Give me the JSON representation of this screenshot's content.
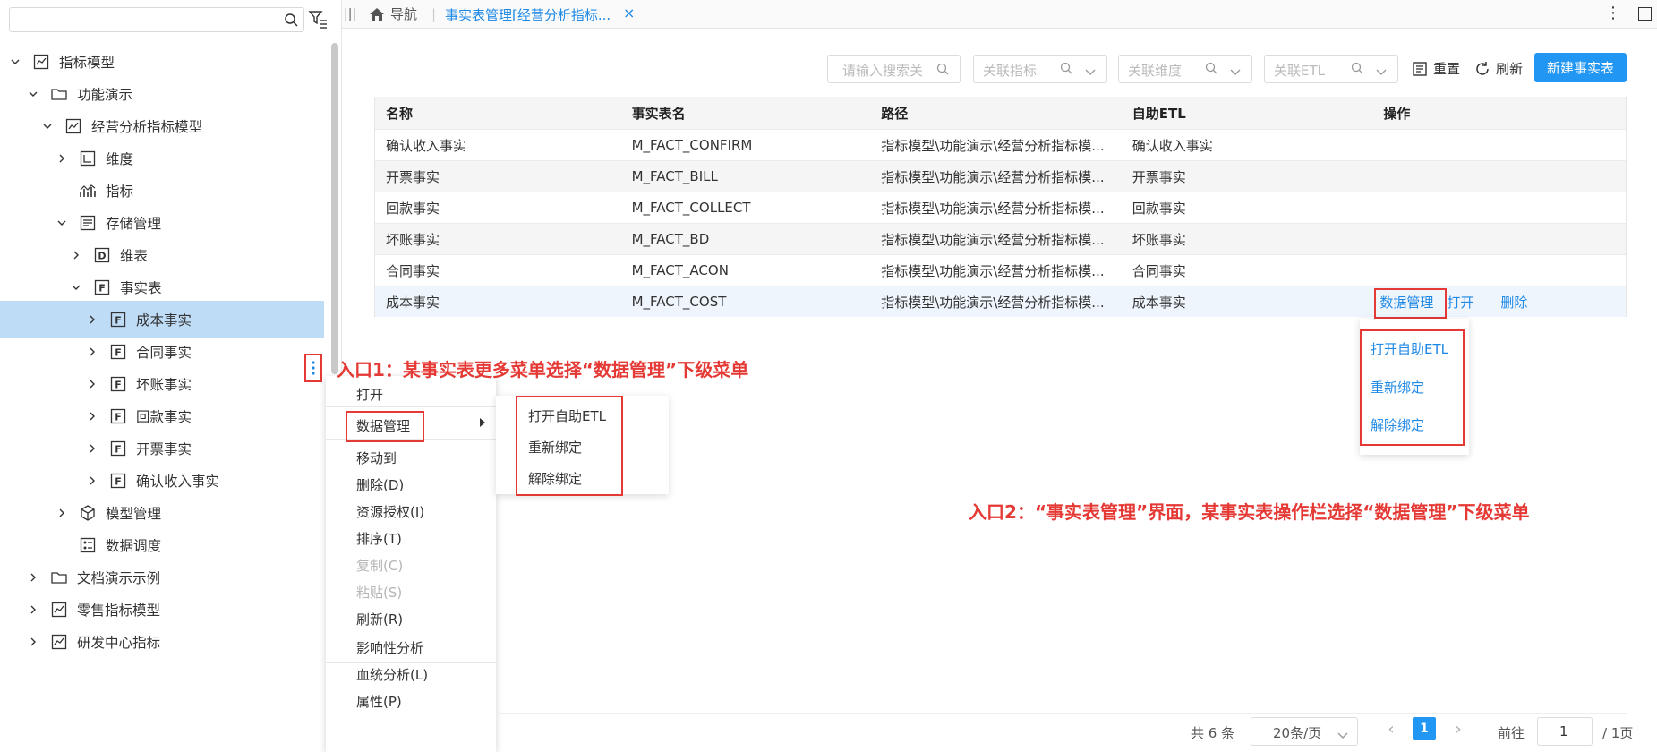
{
  "topbar": {
    "nav_label": "导航",
    "tab_label": "事实表管理[经营分析指标...",
    "tab_close": "×"
  },
  "sidebar": {
    "items": [
      {
        "label": "指标模型",
        "icon": "model-icon",
        "expanded": true
      },
      {
        "label": "功能演示",
        "icon": "folder-icon",
        "expanded": true
      },
      {
        "label": "经营分析指标模型",
        "icon": "model-icon",
        "expanded": true
      },
      {
        "label": "维度",
        "icon": "dimension-icon",
        "expanded": false
      },
      {
        "label": "指标",
        "icon": "metric-icon"
      },
      {
        "label": "存储管理",
        "icon": "storage-icon",
        "expanded": true
      },
      {
        "label": "维表",
        "icon": "dim-table-icon",
        "expanded": false
      },
      {
        "label": "事实表",
        "icon": "fact-table-icon",
        "expanded": true
      },
      {
        "label": "成本事实",
        "icon": "fact-table-icon",
        "expanded": false,
        "selected": true
      },
      {
        "label": "合同事实",
        "icon": "fact-table-icon",
        "expanded": false
      },
      {
        "label": "坏账事实",
        "icon": "fact-table-icon",
        "expanded": false
      },
      {
        "label": "回款事实",
        "icon": "fact-table-icon",
        "expanded": false
      },
      {
        "label": "开票事实",
        "icon": "fact-table-icon",
        "expanded": false
      },
      {
        "label": "确认收入事实",
        "icon": "fact-table-icon",
        "expanded": false
      },
      {
        "label": "模型管理",
        "icon": "cube-icon",
        "expanded": false
      },
      {
        "label": "数据调度",
        "icon": "schedule-icon"
      },
      {
        "label": "文档演示示例",
        "icon": "folder-icon",
        "expanded": false
      },
      {
        "label": "零售指标模型",
        "icon": "model-icon",
        "expanded": false
      },
      {
        "label": "研发中心指标",
        "icon": "model-icon",
        "expanded": false
      }
    ]
  },
  "toolbar": {
    "search_placeholder": "请输入搜索关",
    "filter_metric": "关联指标",
    "filter_dimension": "关联维度",
    "filter_etl": "关联ETL",
    "reset_label": "重置",
    "refresh_label": "刷新",
    "new_label": "新建事实表"
  },
  "table": {
    "headers": [
      "名称",
      "事实表名",
      "路径",
      "自助ETL",
      "操作"
    ],
    "rows": [
      {
        "name": "确认收入事实",
        "table": "M_FACT_CONFIRM",
        "path": "指标模型\\功能演示\\经营分析指标模...",
        "etl": "确认收入事实"
      },
      {
        "name": "开票事实",
        "table": "M_FACT_BILL",
        "path": "指标模型\\功能演示\\经营分析指标模...",
        "etl": "开票事实"
      },
      {
        "name": "回款事实",
        "table": "M_FACT_COLLECT",
        "path": "指标模型\\功能演示\\经营分析指标模...",
        "etl": "回款事实"
      },
      {
        "name": "坏账事实",
        "table": "M_FACT_BD",
        "path": "指标模型\\功能演示\\经营分析指标模...",
        "etl": "坏账事实"
      },
      {
        "name": "合同事实",
        "table": "M_FACT_ACON",
        "path": "指标模型\\功能演示\\经营分析指标模...",
        "etl": "合同事实"
      },
      {
        "name": "成本事实",
        "table": "M_FACT_COST",
        "path": "指标模型\\功能演示\\经营分析指标模...",
        "etl": "成本事实"
      }
    ],
    "actions": {
      "data_manage": "数据管理",
      "open": "打开",
      "delete": "删除"
    }
  },
  "context_menu": {
    "items": [
      "打开",
      "数据管理",
      "移动到",
      "删除(D)",
      "资源授权(I)",
      "排序(T)",
      "复制(C)",
      "粘贴(S)",
      "刷新(R)",
      "影响性分析",
      "血统分析(L)",
      "属性(P)"
    ],
    "disabled": [
      "复制(C)",
      "粘贴(S)"
    ]
  },
  "submenu": {
    "items": [
      "打开自助ETL",
      "重新绑定",
      "解除绑定"
    ]
  },
  "annotations": {
    "entry1": "入口1：某事实表更多菜单选择“数据管理”下级菜单",
    "entry2": "入口2：“事实表管理”界面，某事实表操作栏选择“数据管理”下级菜单"
  },
  "pagination": {
    "total": "共 6 条",
    "page_size": "20条/页",
    "current": "1",
    "goto_label": "前往",
    "goto_value": "1",
    "total_pages": "/ 1页"
  },
  "colors": {
    "accent": "#2196f3",
    "link": "#1e88e5",
    "annotation": "#e53935",
    "selected_row": "#bfdcf7"
  }
}
